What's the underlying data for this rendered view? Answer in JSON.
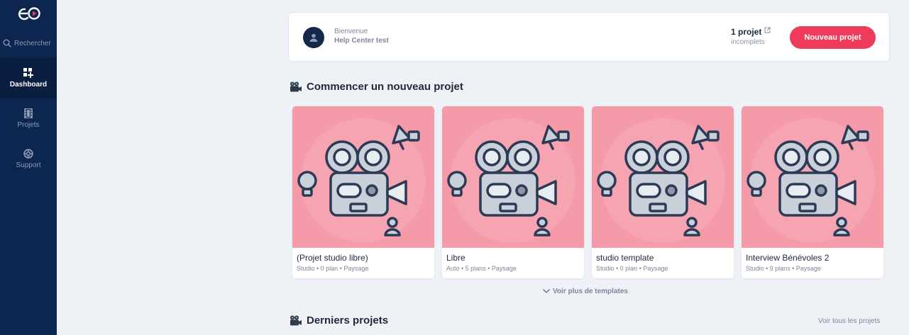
{
  "sidebar": {
    "search_label": "Rechercher",
    "items": [
      {
        "label": "Dashboard",
        "icon": "dashboard-icon",
        "active": true
      },
      {
        "label": "Projets",
        "icon": "film-icon",
        "active": false
      },
      {
        "label": "Support",
        "icon": "lifebuoy-icon",
        "active": false
      }
    ]
  },
  "header": {
    "welcome": "Bienvenue",
    "username": "Help Center test",
    "project_count": "1 projet",
    "project_status": "incomplets",
    "new_project_button": "Nouveau projet"
  },
  "templates_section": {
    "title": "Commencer un nouveau projet",
    "show_more": "Voir plus de templates",
    "cards": [
      {
        "title": "(Projet studio libre)",
        "meta": "Studio • 0 plan • Paysage"
      },
      {
        "title": "Libre",
        "meta": "Auto • 5 plans • Paysage"
      },
      {
        "title": "studio template",
        "meta": "Studio • 0 plan • Paysage"
      },
      {
        "title": "Interview Bénévoles 2",
        "meta": "Studio • 9 plans • Paysage"
      }
    ]
  },
  "recent_section": {
    "title": "Derniers projets",
    "see_all": "Voir tous les projets"
  },
  "colors": {
    "sidebar": "#0d2650",
    "accent": "#ef3b5a",
    "card_image": "#f59aa9",
    "background": "#eef2f7"
  }
}
